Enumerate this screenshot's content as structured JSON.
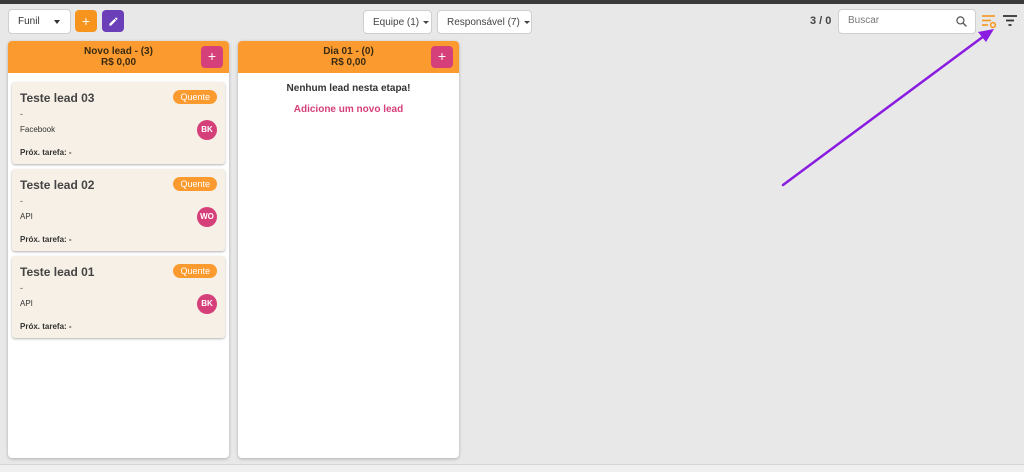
{
  "toolbar": {
    "funnel_select": "Funil",
    "team_filter": "Equipe (1)",
    "owner_filter": "Responsável (7)",
    "counter": "3 / 0",
    "search_placeholder": "Buscar"
  },
  "columns": [
    {
      "title": "Novo lead - (3)",
      "amount": "R$ 0,00",
      "add_label": "+",
      "cards": [
        {
          "title": "Teste lead 03",
          "badge": "Quente",
          "detail": "-",
          "source": "Facebook",
          "avatar": "BK",
          "next_task": "Próx. tarefa: -"
        },
        {
          "title": "Teste lead 02",
          "badge": "Quente",
          "detail": "-",
          "source": "API",
          "avatar": "WO",
          "next_task": "Próx. tarefa: -"
        },
        {
          "title": "Teste lead 01",
          "badge": "Quente",
          "detail": "-",
          "source": "API",
          "avatar": "BK",
          "next_task": "Próx. tarefa: -"
        }
      ]
    },
    {
      "title": "Dia 01 - (0)",
      "amount": "R$ 0,00",
      "add_label": "+",
      "empty_message": "Nenhum lead nesta etapa!",
      "empty_action": "Adicione um novo lead"
    }
  ],
  "colors": {
    "accent_orange": "#fb9b2f",
    "accent_pink": "#d6407a",
    "accent_purple": "#6a3fb7",
    "annotation_arrow": "#8a1be0"
  },
  "icons": {
    "add": "plus-icon",
    "edit": "pencil-icon",
    "search": "search-icon",
    "sort": "sort-settings-icon",
    "filter": "filter-icon"
  }
}
